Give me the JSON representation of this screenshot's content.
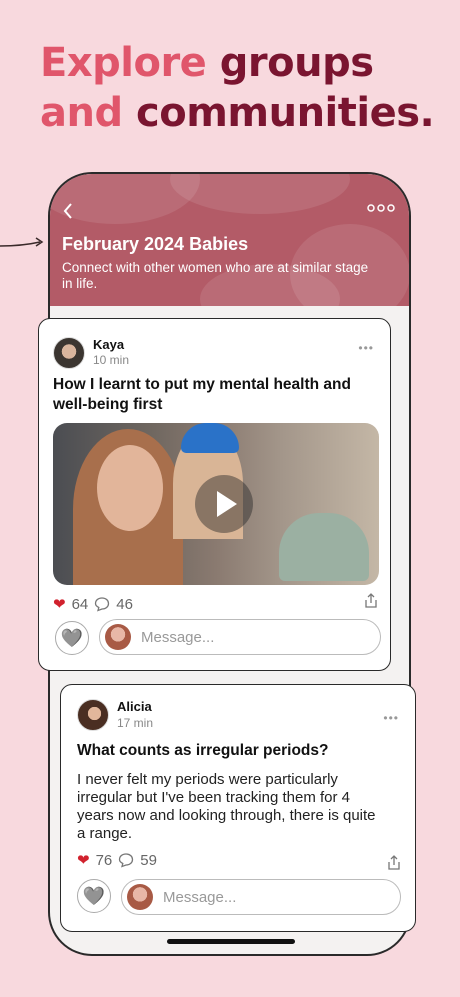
{
  "headline": {
    "line1_a": "Explore",
    "line1_b": "groups",
    "line2_a": "and",
    "line2_b": "communities."
  },
  "group": {
    "back_icon": "chevron-left-icon",
    "more_icon": "ellipsis-icon",
    "title": "February 2024 Babies",
    "description": "Connect with other women who are at similar stage in life."
  },
  "posts": [
    {
      "author": "Kaya",
      "time": "10 min",
      "title": "How I learnt to put my mental health and well-being first",
      "likes": "64",
      "comments": "46",
      "has_video": true,
      "message_placeholder": "Message..."
    },
    {
      "author": "Alicia",
      "time": "17 min",
      "title": "What counts as irregular periods?",
      "body": "I never felt my periods were particularly irregular but I've been tracking them for 4 years now and looking through, there is quite a range.",
      "likes": "76",
      "comments": "59",
      "message_placeholder": "Message..."
    }
  ],
  "colors": {
    "accent_pink": "#e0566b",
    "accent_dark": "#7a1530",
    "header": "#b35b67",
    "background": "#f8d9de"
  }
}
